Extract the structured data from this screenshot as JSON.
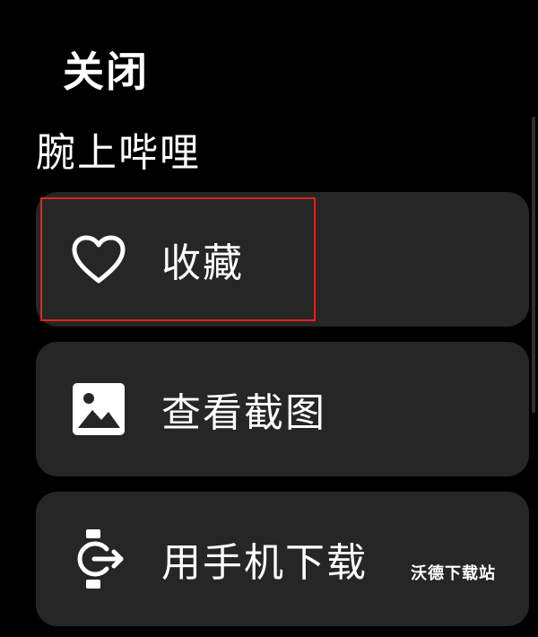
{
  "header": {
    "close_label": "关闭",
    "title": "腕上哔哩"
  },
  "menu": {
    "items": [
      {
        "label": "收藏",
        "icon": "heart-icon"
      },
      {
        "label": "查看截图",
        "icon": "image-icon"
      },
      {
        "label": "用手机下载",
        "icon": "watch-export-icon"
      }
    ]
  },
  "watermark": {
    "text": "沃德下载站"
  },
  "colors": {
    "background": "#000000",
    "card": "#262626",
    "text": "#ffffff",
    "highlight": "#e0241e"
  }
}
